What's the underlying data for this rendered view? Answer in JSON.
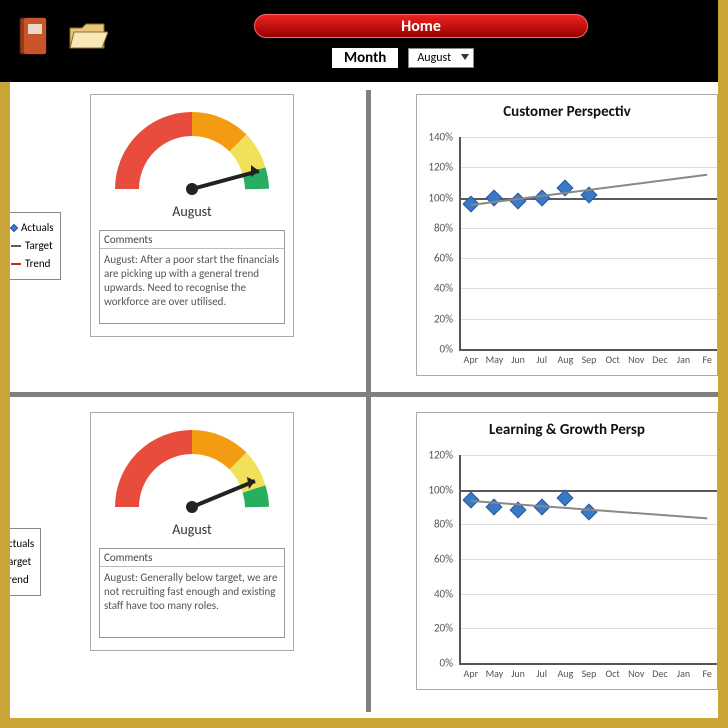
{
  "topbar": {
    "home_label": "Home",
    "month_label": "Month",
    "month_value": "August"
  },
  "legend": {
    "actuals": "Actuals",
    "target": "Target",
    "trend": "Trend"
  },
  "legend_partial": {
    "actuals": "ctuals",
    "target": "arget",
    "trend": "rend"
  },
  "panel_customer": {
    "gauge_month": "August",
    "comments_label": "Comments",
    "comments_text": "August: After a poor start the financials are picking up with a general trend upwards. Need to recognise the workforce are over utilised."
  },
  "panel_learning": {
    "gauge_month": "August",
    "comments_label": "Comments",
    "comments_text": "August: Generally below target, we are not recruiting fast enough and existing staff have too many roles."
  },
  "chart_customer": {
    "title": "Customer Perspectiv"
  },
  "chart_learning": {
    "title": "Learning & Growth Persp"
  },
  "chart_data": [
    {
      "type": "line",
      "title": "Customer Perspective",
      "ylabel": "",
      "ylim": [
        0,
        140
      ],
      "target": 100,
      "categories": [
        "Apr",
        "May",
        "Jun",
        "Jul",
        "Aug",
        "Sep",
        "Oct",
        "Nov",
        "Dec",
        "Jan",
        "Fe"
      ],
      "y_ticks": [
        "0%",
        "20%",
        "40%",
        "60%",
        "80%",
        "100%",
        "120%",
        "140%"
      ],
      "series": [
        {
          "name": "Actuals",
          "values": [
            96,
            100,
            98,
            100,
            106,
            102
          ]
        },
        {
          "name": "Target",
          "values": [
            100,
            100,
            100,
            100,
            100,
            100,
            100,
            100,
            100,
            100,
            100
          ]
        },
        {
          "name": "Trend",
          "values": [
            96,
            98,
            100,
            102,
            104,
            106,
            108,
            110,
            112,
            114,
            116
          ]
        }
      ]
    },
    {
      "type": "line",
      "title": "Learning & Growth Perspective",
      "ylabel": "",
      "ylim": [
        0,
        120
      ],
      "target": 100,
      "categories": [
        "Apr",
        "May",
        "Jun",
        "Jul",
        "Aug",
        "Sep",
        "Oct",
        "Nov",
        "Dec",
        "Jan",
        "Fe"
      ],
      "y_ticks": [
        "0%",
        "20%",
        "40%",
        "60%",
        "80%",
        "100%",
        "120%"
      ],
      "series": [
        {
          "name": "Actuals",
          "values": [
            94,
            90,
            88,
            90,
            95,
            87
          ]
        },
        {
          "name": "Target",
          "values": [
            100,
            100,
            100,
            100,
            100,
            100,
            100,
            100,
            100,
            100,
            100
          ]
        },
        {
          "name": "Trend",
          "values": [
            94,
            93,
            92,
            91,
            90,
            89,
            88,
            87,
            86,
            85,
            84
          ]
        }
      ]
    }
  ]
}
